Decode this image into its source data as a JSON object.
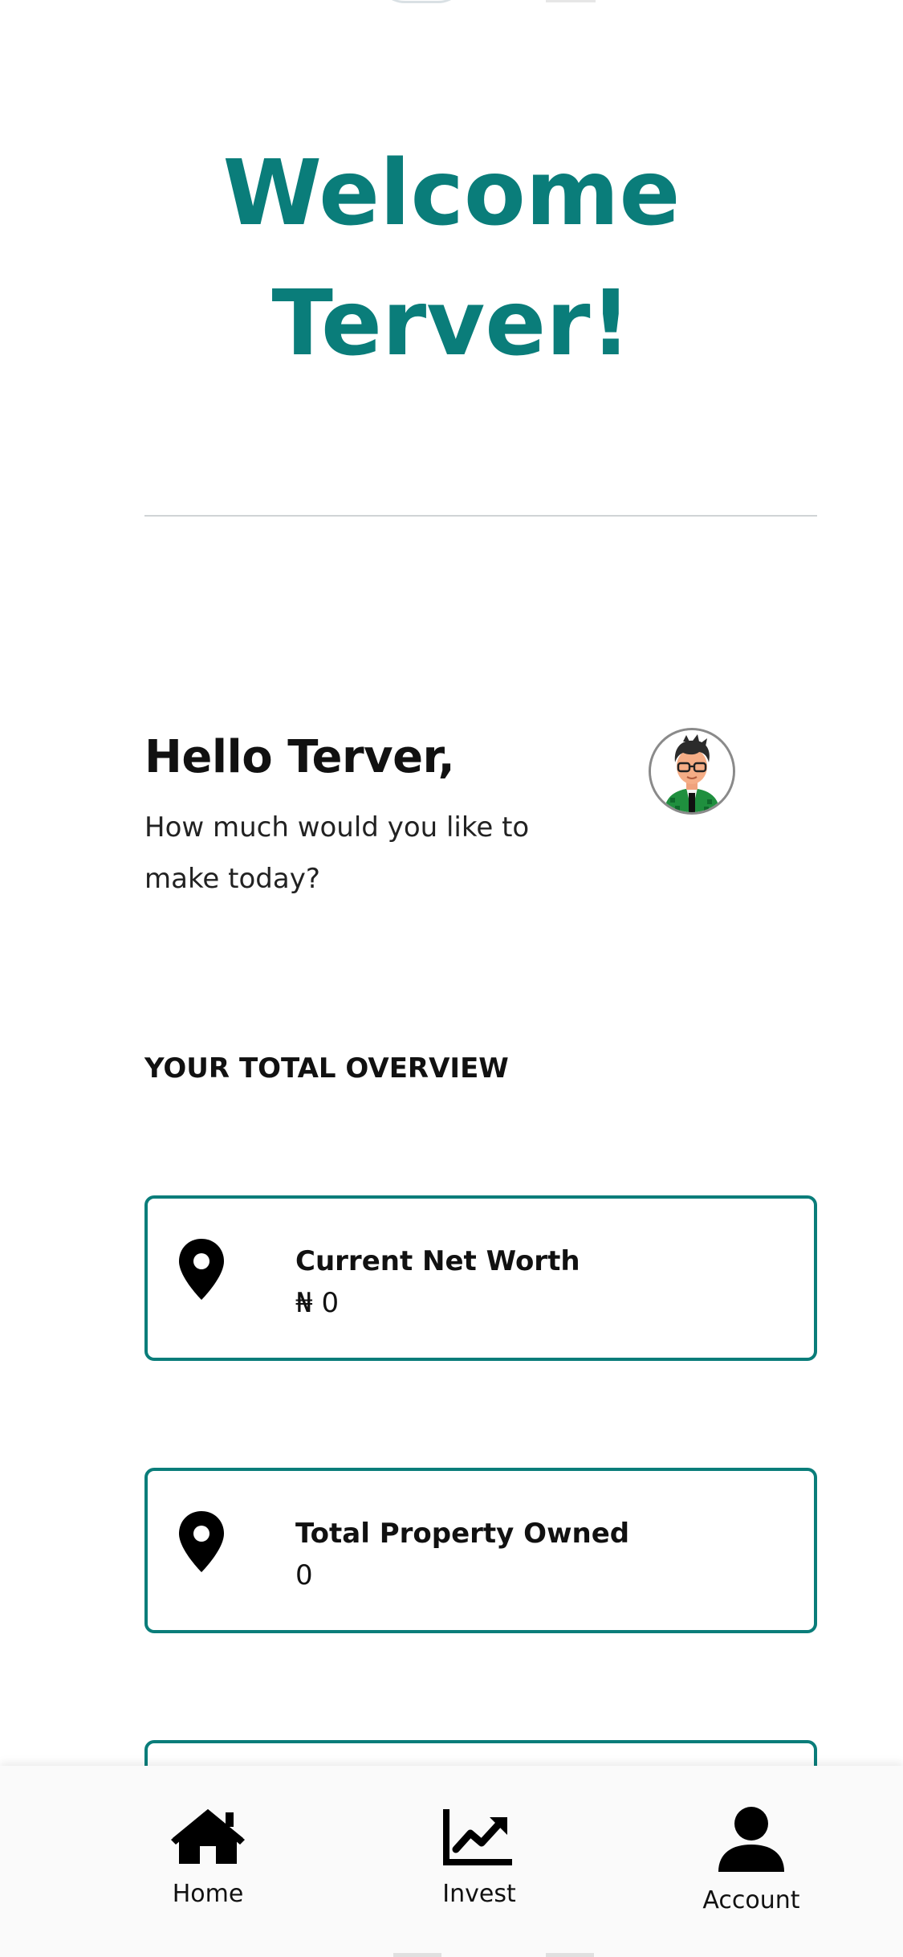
{
  "welcome": {
    "line1": "Welcome",
    "line2": "Terver!"
  },
  "greeting": {
    "hello": "Hello Terver,",
    "prompt_line1": "How much would you like to",
    "prompt_line2": "make today?"
  },
  "overview": {
    "title": "YOUR TOTAL OVERVIEW",
    "cards": [
      {
        "label": "Current Net Worth",
        "value": "₦ 0",
        "icon": "map-pin-icon"
      },
      {
        "label": "Total Property Owned",
        "value": "0",
        "icon": "map-pin-icon"
      }
    ]
  },
  "nav": {
    "items": [
      {
        "label": "Home",
        "icon": "home-icon"
      },
      {
        "label": "Invest",
        "icon": "chart-line-icon"
      },
      {
        "label": "Account",
        "icon": "user-icon"
      }
    ]
  },
  "colors": {
    "accent": "#0a7d7a",
    "text": "#111111",
    "divider": "#d0d4d6"
  }
}
